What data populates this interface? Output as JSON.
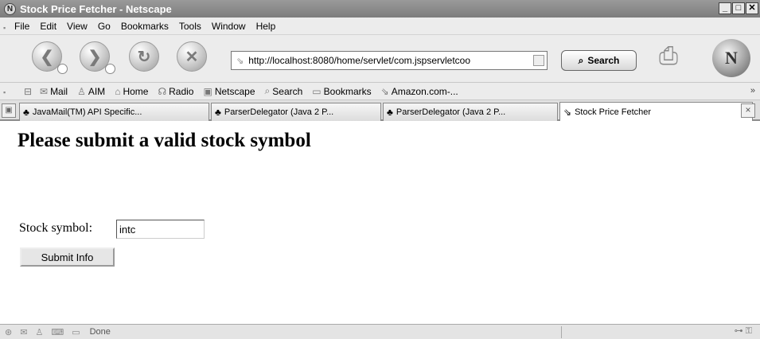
{
  "window": {
    "title": "Stock Price Fetcher - Netscape",
    "controls": [
      "_",
      "□",
      "✕"
    ]
  },
  "menu": [
    {
      "label": "File"
    },
    {
      "label": "Edit"
    },
    {
      "label": "View"
    },
    {
      "label": "Go"
    },
    {
      "label": "Bookmarks"
    },
    {
      "label": "Tools"
    },
    {
      "label": "Window"
    },
    {
      "label": "Help"
    }
  ],
  "nav": {
    "url": "http://localhost:8080/home/servlet/com.jspservletcoo",
    "search_label": "Search"
  },
  "personal_toolbar": [
    {
      "icon": "✉",
      "label": "Mail"
    },
    {
      "icon": "♙",
      "label": "AIM"
    },
    {
      "icon": "⌂",
      "label": "Home"
    },
    {
      "icon": "☊",
      "label": "Radio"
    },
    {
      "icon": "▣",
      "label": "Netscape"
    },
    {
      "icon": "⌕",
      "label": "Search"
    },
    {
      "icon": "▭",
      "label": "Bookmarks"
    },
    {
      "icon": "⇘",
      "label": "Amazon.com-..."
    }
  ],
  "personal_toolbar_more": "»",
  "tabs": [
    {
      "label": "JavaMail(TM) API Specific..."
    },
    {
      "label": "ParserDelegator (Java 2 P..."
    },
    {
      "label": "ParserDelegator (Java 2 P..."
    },
    {
      "label": "Stock Price Fetcher"
    }
  ],
  "page": {
    "heading": "Please submit a valid stock symbol",
    "symbol_label": "Stock symbol:",
    "symbol_value": "intc",
    "submit_label": "Submit Info"
  },
  "status": {
    "text": "Done"
  }
}
